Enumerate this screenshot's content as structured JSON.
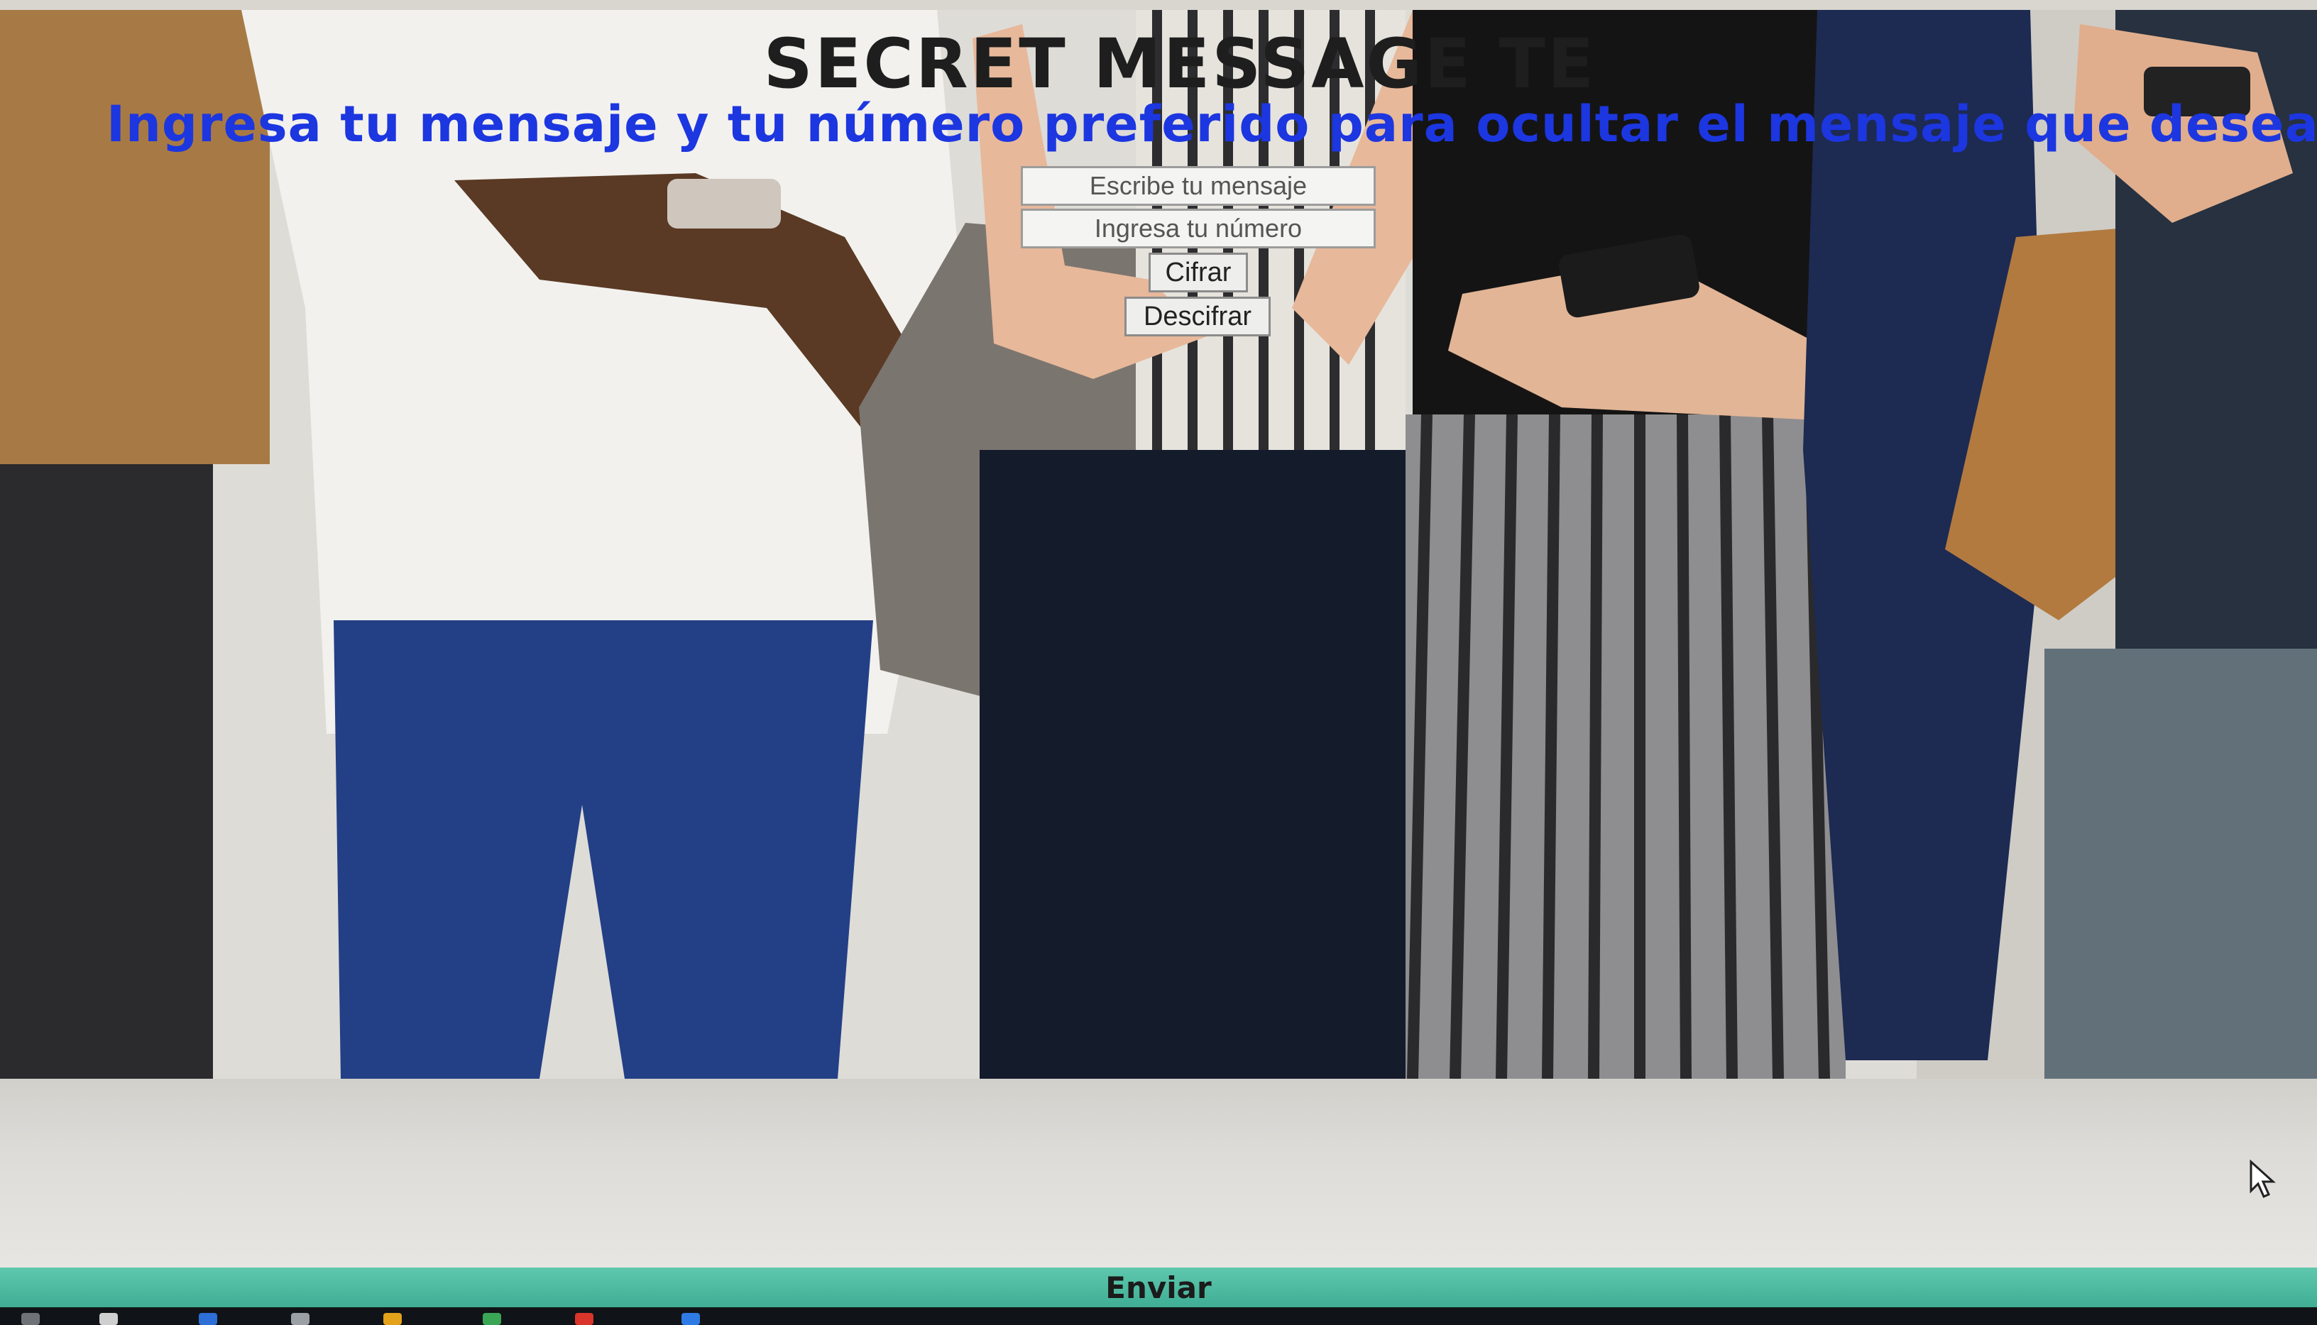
{
  "page": {
    "title": "SECRET MESSAGE TE",
    "subtitle": "Ingresa tu mensaje y tu número preferido para ocultar el mensaje que deseas enviar"
  },
  "form": {
    "message_placeholder": "Escribe tu mensaje",
    "number_placeholder": "Ingresa tu número",
    "encrypt_label": "Cifrar",
    "decrypt_label": "Descifrar"
  },
  "footer": {
    "send_label": "Enviar"
  },
  "colors": {
    "title": "#1e1e1e",
    "subtitle": "#1c36e0",
    "footer_bar": "#4fbfa3"
  }
}
